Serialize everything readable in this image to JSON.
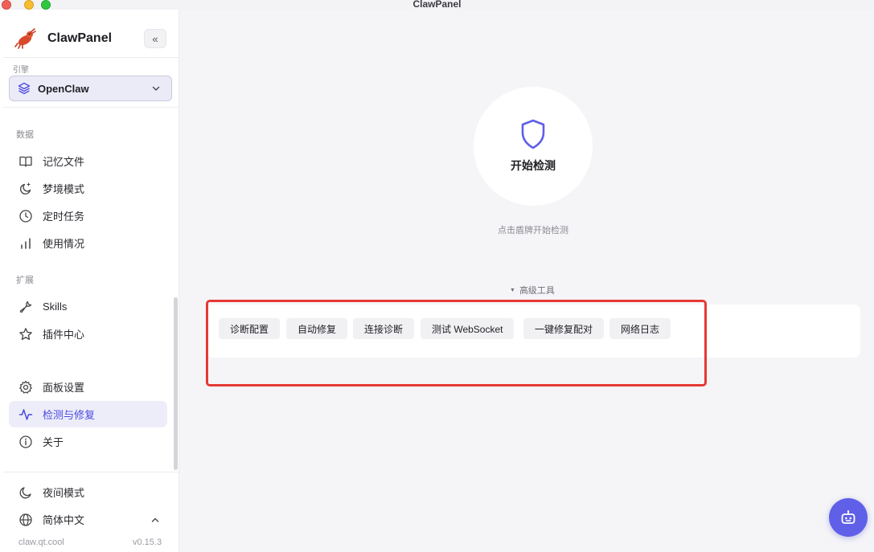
{
  "window": {
    "title": "ClawPanel"
  },
  "sidebar": {
    "app_name": "ClawPanel",
    "collapse_label": "«",
    "engine": {
      "label": "引擎",
      "selected": "OpenClaw"
    },
    "sections": {
      "data": "数据",
      "extend": "扩展"
    },
    "items": [
      {
        "label": "记忆文件",
        "icon": "book-icon"
      },
      {
        "label": "梦境模式",
        "icon": "moon-star-icon"
      },
      {
        "label": "定时任务",
        "icon": "clock-icon"
      },
      {
        "label": "使用情况",
        "icon": "bar-chart-icon"
      },
      {
        "label": "Skills",
        "icon": "wrench-icon"
      },
      {
        "label": "插件中心",
        "icon": "star-icon"
      },
      {
        "label": "面板设置",
        "icon": "gear-icon"
      },
      {
        "label": "检测与修复",
        "icon": "activity-icon",
        "active": true
      },
      {
        "label": "关于",
        "icon": "info-icon"
      }
    ],
    "bottom": {
      "night_mode": "夜间模式",
      "language": "简体中文"
    },
    "footer": {
      "url": "claw.qt.cool",
      "version": "v0.15.3"
    }
  },
  "main": {
    "start_button": "开始检测",
    "hint": "点击盾牌开始检测",
    "advanced_toggle": "高级工具",
    "tools": [
      "诊断配置",
      "自动修复",
      "连接诊断",
      "测试 WebSocket",
      "一键修复配对",
      "网络日志"
    ]
  },
  "colors": {
    "accent": "#5f5fe8",
    "active_bg": "#ededfa",
    "highlight_border": "#e53935"
  }
}
